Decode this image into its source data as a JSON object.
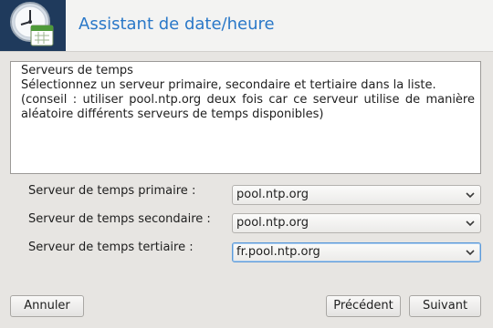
{
  "header": {
    "title": "Assistant de date/heure",
    "icon": "clock-calendar-icon"
  },
  "info": {
    "line1": "Serveurs de temps",
    "line2": "Sélectionnez un serveur primaire, secondaire et tertiaire dans la liste.",
    "line3a": "(conseil : utiliser pool.ntp.org deux fois car ce serveur utilise de manière",
    "line3b": "aléatoire différents serveurs de temps disponibles)"
  },
  "form": {
    "primary_label": "Serveur de temps primaire :",
    "primary_value": "pool.ntp.org",
    "secondary_label": "Serveur de temps secondaire :",
    "secondary_value": "pool.ntp.org",
    "tertiary_label": "Serveur de temps tertiaire :",
    "tertiary_value": "fr.pool.ntp.org"
  },
  "buttons": {
    "cancel": "Annuler",
    "previous": "Précédent",
    "next": "Suivant"
  },
  "colors": {
    "accent": "#2a78c8",
    "icon_bg": "#1f3a5c",
    "focus": "#5d9ad8"
  }
}
